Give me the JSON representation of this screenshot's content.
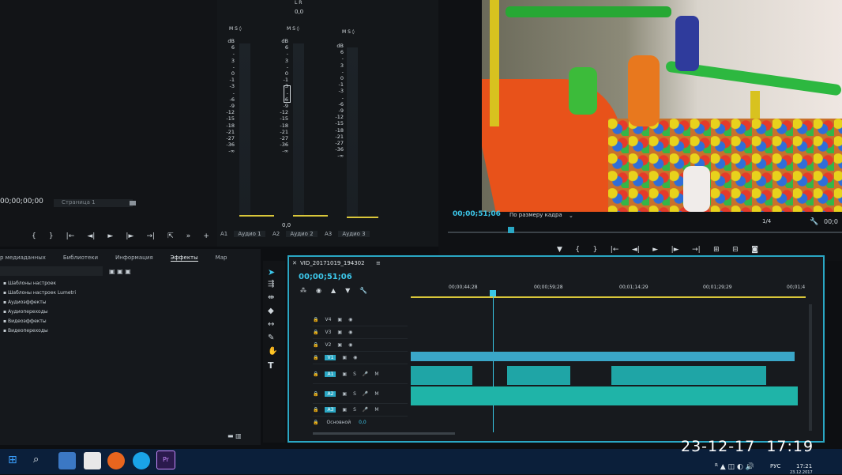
{
  "source": {
    "timecode": "00;00;00;00",
    "page_label": "Страница 1",
    "controls": [
      "{",
      "}",
      "|←",
      "◄|",
      "►",
      "|►",
      "→|",
      "⇱",
      "»",
      "+"
    ]
  },
  "mixer": {
    "header_value": "0,0",
    "header_lr": "L  R",
    "scale": [
      "dB",
      "6",
      "-",
      "3",
      "-",
      "0",
      "-1",
      "-3",
      "-",
      "-6",
      "-9",
      "-12",
      "-15",
      "-18",
      "-21",
      "-27",
      "-36",
      "-∞"
    ],
    "msr": "M S ◊",
    "bottom_value": "0,0",
    "channels": [
      {
        "id": "A1",
        "name": "Аудио 1"
      },
      {
        "id": "A2",
        "name": "Аудио 2"
      },
      {
        "id": "A3",
        "name": "Аудио 3"
      }
    ]
  },
  "program": {
    "timecode": "00;00;51;06",
    "fit_label": "По размеру кадра",
    "resolution": "1/4",
    "end_timecode": "00;0"
  },
  "effects": {
    "tabs": [
      "р медиаданных",
      "Библиотеки",
      "Информация",
      "Эффекты",
      "Мар"
    ],
    "active_tab": "Эффекты",
    "items": [
      "Шаблоны настроек",
      "Шаблоны настроек Lumetri",
      "Аудиоэффекты",
      "Аудиопереходы",
      "Видеоэффекты",
      "Видеопереходы"
    ]
  },
  "timeline": {
    "sequence_name": "VID_20171019_194302",
    "timecode": "00;00;51;06",
    "ruler": [
      "00;00;44;28",
      "00;00;59;28",
      "00;01;14;29",
      "00;01;29;29",
      "00;01;4"
    ],
    "tracks": [
      "V4",
      "V3",
      "V2",
      "V1",
      "A1",
      "A2",
      "A3"
    ],
    "master_label": "Основной",
    "master_value": "0,0",
    "colors": {
      "accent": "#2aa7c4",
      "video_clip": "#3aa6c8",
      "audio_clip": "#1fa5a6",
      "playhead": "#39c8e6"
    }
  },
  "taskbar": {
    "lang": "РУС",
    "time": "17:21",
    "date": "23.12.2017"
  },
  "photo_stamp": "23-12-17  17:19"
}
